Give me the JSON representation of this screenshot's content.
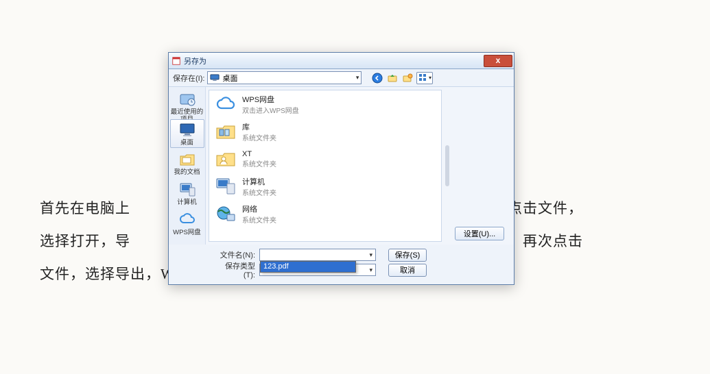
{
  "background_text": "首先在电脑上　　　　　　　　　　　　　　　　　　　　　　　上角点击文件，\n选择打开，导　　　　　　　　　　　　　　　　　　　　　　　开始，再次点击\n文件，选择导出，Word 文档，选择导出路径就可以了",
  "dialog": {
    "title": "另存为",
    "save_in_label": "保存在(I):",
    "save_in_value": "桌面",
    "sidebar": {
      "items": [
        {
          "label": "最近使用的项目"
        },
        {
          "label": "桌面"
        },
        {
          "label": "我的文档"
        },
        {
          "label": "计算机"
        },
        {
          "label": "WPS网盘"
        }
      ]
    },
    "files": [
      {
        "title": "WPS网盘",
        "subtitle": "双击进入WPS网盘",
        "icon": "cloud"
      },
      {
        "title": "库",
        "subtitle": "系统文件夹",
        "icon": "folder"
      },
      {
        "title": "XT",
        "subtitle": "系统文件夹",
        "icon": "folder"
      },
      {
        "title": "计算机",
        "subtitle": "系统文件夹",
        "icon": "computer"
      },
      {
        "title": "网络",
        "subtitle": "系统文件夹",
        "icon": "network"
      }
    ],
    "settings_button": "设置(U)...",
    "filename_label": "文件名(N):",
    "filename_value": "",
    "filename_dropdown_option": "123.pdf",
    "filetype_label": "保存类型(T):",
    "filetype_value": "",
    "save_button": "保存(S)",
    "cancel_button": "取消"
  }
}
